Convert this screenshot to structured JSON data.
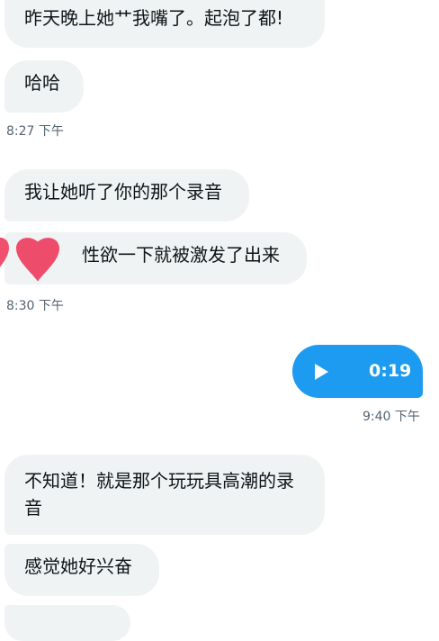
{
  "messages": [
    {
      "text": "昨天晚上她艹我嘴了。起泡了都!"
    },
    {
      "text": "哈哈"
    },
    {
      "text": "我让她听了你的那个录音"
    },
    {
      "text": "性欲一下就被激发了出来"
    },
    {
      "text": "不知道！就是那个玩玩具高潮的录音"
    },
    {
      "text": "感觉她好兴奋"
    }
  ],
  "timestamps": [
    "8:27 下午",
    "8:30 下午",
    "9:40 下午"
  ],
  "voice": {
    "duration": "0:19",
    "icon": "play-icon"
  },
  "reaction": {
    "icon": "heart-icon",
    "color": "#f0506e"
  },
  "colors": {
    "incoming_bubble": "#eff3f4",
    "outgoing_bubble": "#1d9bf0",
    "timestamp": "#536471"
  }
}
